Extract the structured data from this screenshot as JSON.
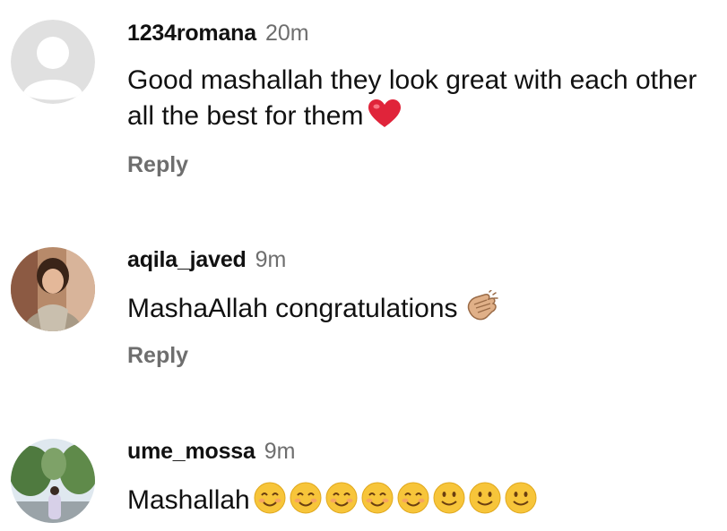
{
  "comments": [
    {
      "username": "1234romana",
      "time": "20m",
      "text": "Good mashallah they look great with each other all the best for them",
      "emojis": [
        "red-heart"
      ],
      "reply_label": "Reply",
      "avatar": "default-avatar"
    },
    {
      "username": "aqila_javed",
      "time": "9m",
      "text": "MashaAllah congratulations",
      "emojis": [
        "clapping-hands"
      ],
      "reply_label": "Reply",
      "avatar": "user-photo"
    },
    {
      "username": "ume_mossa",
      "time": "9m",
      "text": "Mashallah",
      "emojis": [
        "smiling-face-with-smiling-eyes",
        "smiling-face-with-smiling-eyes",
        "smiling-face-with-smiling-eyes",
        "smiling-face-with-smiling-eyes",
        "smiling-face-with-smiling-eyes",
        "slightly-smiling-face",
        "slightly-smiling-face",
        "slightly-smiling-face"
      ],
      "avatar": "user-photo"
    }
  ],
  "colors": {
    "username": "#111111",
    "time": "#6e6e6e",
    "reply": "#6e6e6e",
    "default_avatar_bg": "#e0e0e0",
    "heart": "#e0243a",
    "emoji_face": "#f7c53a"
  }
}
